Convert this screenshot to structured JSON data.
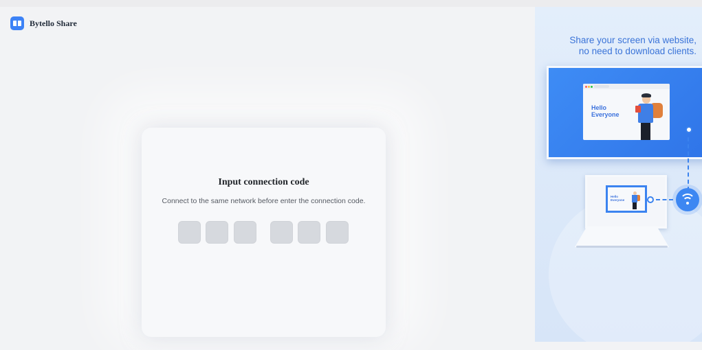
{
  "app": {
    "name": "Bytello Share",
    "logo_icon": "bytello-logo-icon"
  },
  "connect": {
    "title": "Input connection code",
    "subtitle": "Connect to the same network before enter the connection code.",
    "code_digits": [
      "",
      "",
      "",
      "",
      "",
      ""
    ]
  },
  "promo": {
    "tagline_line1": "Share your screen via website,",
    "tagline_line2": "no need to download clients.",
    "illustration_text": "Hello Everyone",
    "small_illustration_text": "Hello Everyone",
    "network_icon": "wifi-icon"
  },
  "colors": {
    "accent": "#3c82f6",
    "tagline": "#3a73d8",
    "panel_bg": "#e3eefb",
    "page_bg": "#f2f3f5"
  }
}
